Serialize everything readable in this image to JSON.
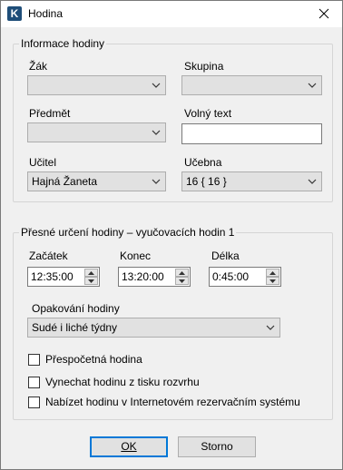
{
  "window": {
    "title": "Hodina",
    "app_icon": "K"
  },
  "info_group": {
    "legend": "Informace hodiny",
    "zak": {
      "label": "Žák",
      "value": ""
    },
    "skupina": {
      "label": "Skupina",
      "value": ""
    },
    "predmet": {
      "label": "Předmět",
      "value": ""
    },
    "volny_text": {
      "label": "Volný text",
      "value": ""
    },
    "ucitel": {
      "label": "Učitel",
      "value": "Hajná Žaneta"
    },
    "ucebna": {
      "label": "Učebna",
      "value": "16 { 16 }"
    }
  },
  "timing_group": {
    "legend": "Přesné určení hodiny  –  vyučovacích hodin 1",
    "zacatek": {
      "label": "Začátek",
      "value": "12:35:00"
    },
    "konec": {
      "label": "Konec",
      "value": "13:20:00"
    },
    "delka": {
      "label": "Délka",
      "value": "0:45:00"
    },
    "opakovani": {
      "label": "Opakování hodiny",
      "value": "Sudé i liché týdny"
    },
    "checkboxes": [
      {
        "label": "Přespočetná hodina",
        "checked": false
      },
      {
        "label": "Vynechat hodinu z tisku rozvrhu",
        "checked": false
      },
      {
        "label": "Nabízet hodinu v Internetovém rezervačním systému",
        "checked": false
      }
    ]
  },
  "buttons": {
    "ok": "OK",
    "cancel": "Storno"
  },
  "colors": {
    "accent": "#0078d7",
    "background": "#f0f0f0",
    "icon": "#1f4e79"
  }
}
